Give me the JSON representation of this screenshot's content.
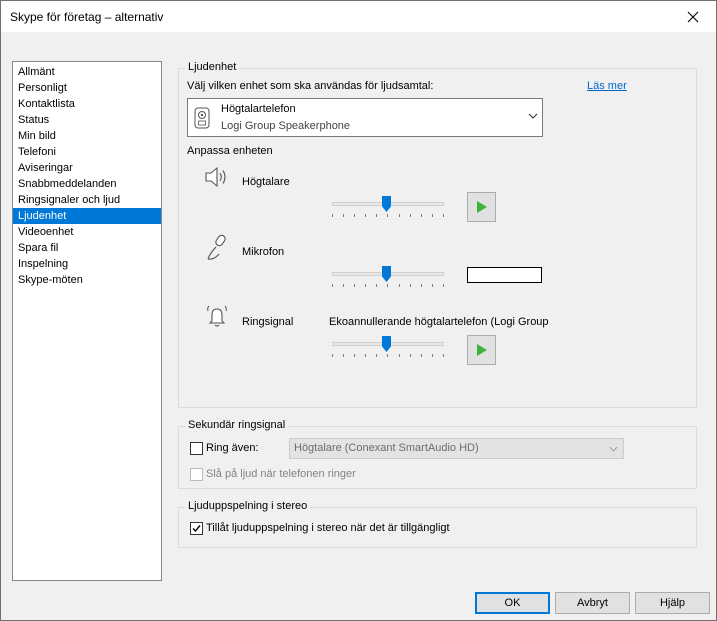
{
  "window": {
    "title": "Skype för företag – alternativ"
  },
  "nav": {
    "items": [
      {
        "label": "Allmänt",
        "selected": false
      },
      {
        "label": "Personligt",
        "selected": false
      },
      {
        "label": "Kontaktlista",
        "selected": false
      },
      {
        "label": "Status",
        "selected": false
      },
      {
        "label": "Min bild",
        "selected": false
      },
      {
        "label": "Telefoni",
        "selected": false
      },
      {
        "label": "Aviseringar",
        "selected": false
      },
      {
        "label": "Snabbmeddelanden",
        "selected": false
      },
      {
        "label": "Ringsignaler och ljud",
        "selected": false
      },
      {
        "label": "Ljudenhet",
        "selected": true
      },
      {
        "label": "Videoenhet",
        "selected": false
      },
      {
        "label": "Spara fil",
        "selected": false
      },
      {
        "label": "Inspelning",
        "selected": false
      },
      {
        "label": "Skype-möten",
        "selected": false
      }
    ]
  },
  "audio_device": {
    "group_title": "Ljudenhet",
    "prompt": "Välj vilken enhet som ska användas för ljudsamtal:",
    "learn_more": "Läs mer",
    "selected_device": {
      "name": "Högtalartelefon",
      "detail": "Logi Group Speakerphone",
      "icon": "speakerphone-icon"
    },
    "customize_title": "Anpassa enheten",
    "speaker": {
      "label": "Högtalare",
      "icon": "speaker-icon",
      "level": 0.4
    },
    "microphone": {
      "label": "Mikrofon",
      "icon": "microphone-icon",
      "level": 0.4
    },
    "ringer": {
      "label": "Ringsignal",
      "icon": "bell-icon",
      "device": "Ekoannullerande högtalartelefon (Logi Group",
      "level": 0.4
    }
  },
  "secondary_ringer": {
    "group_title": "Sekundär ringsignal",
    "ring_also_label": "Ring även:",
    "ring_also_checked": false,
    "ring_also_device": "Högtalare (Conexant SmartAudio HD)",
    "unmute_label": "Slå på ljud när telefonen ringer",
    "unmute_checked": false
  },
  "stereo": {
    "group_title": "Ljuduppspelning i stereo",
    "allow_label": "Tillåt ljuduppspelning i stereo när det är tillgängligt",
    "allow_checked": true
  },
  "buttons": {
    "ok": "OK",
    "cancel": "Avbryt",
    "help": "Hjälp"
  },
  "colors": {
    "accent": "#0078d7",
    "play_green": "#3cb43c",
    "link": "#0066cc"
  }
}
